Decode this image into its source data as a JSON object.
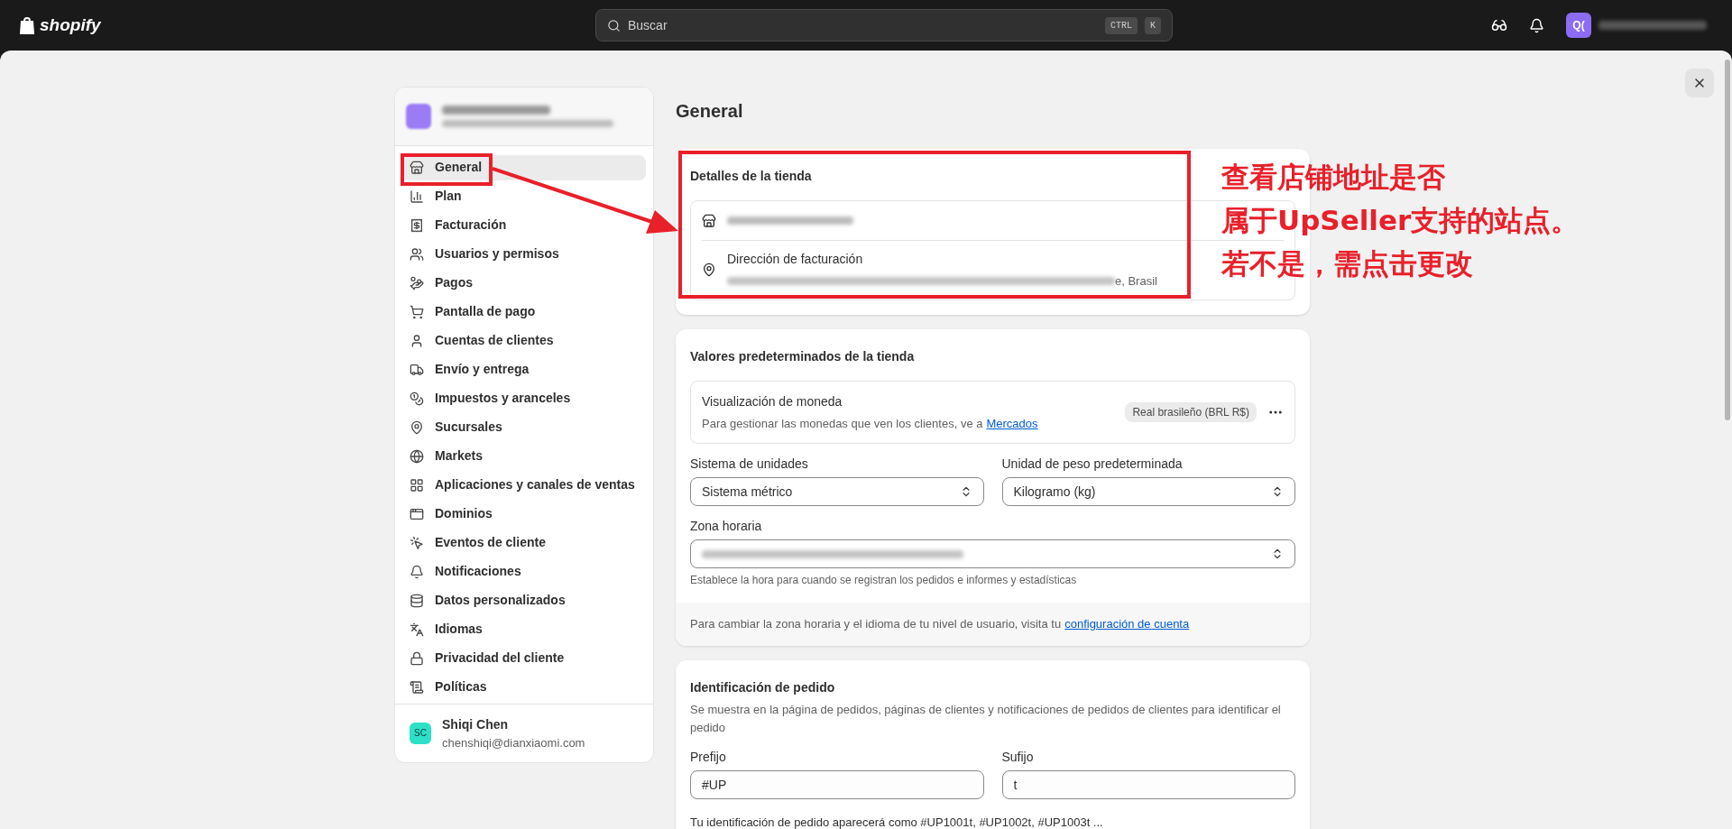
{
  "top_bar": {
    "logo": "shopify",
    "search": {
      "placeholder": "Buscar",
      "shortcut": [
        "CTRL",
        "K"
      ]
    },
    "avatar_initials": "Q("
  },
  "sidebar": {
    "items": [
      {
        "label": "General",
        "selected": true
      },
      {
        "label": "Plan",
        "selected": false
      },
      {
        "label": "Facturación",
        "selected": false
      },
      {
        "label": "Usuarios y permisos",
        "selected": false
      },
      {
        "label": "Pagos",
        "selected": false
      },
      {
        "label": "Pantalla de pago",
        "selected": false
      },
      {
        "label": "Cuentas de clientes",
        "selected": false
      },
      {
        "label": "Envío y entrega",
        "selected": false
      },
      {
        "label": "Impuestos y aranceles",
        "selected": false
      },
      {
        "label": "Sucursales",
        "selected": false
      },
      {
        "label": "Markets",
        "selected": false
      },
      {
        "label": "Aplicaciones y canales de ventas",
        "selected": false
      },
      {
        "label": "Dominios",
        "selected": false
      },
      {
        "label": "Eventos de cliente",
        "selected": false
      },
      {
        "label": "Notificaciones",
        "selected": false
      },
      {
        "label": "Datos personalizados",
        "selected": false
      },
      {
        "label": "Idiomas",
        "selected": false
      },
      {
        "label": "Privacidad del cliente",
        "selected": false
      },
      {
        "label": "Políticas",
        "selected": false
      }
    ],
    "user": {
      "initials": "SC",
      "name": "Shiqi Chen",
      "email": "chenshiqi@dianxiaomi.com"
    }
  },
  "page_title": "General",
  "store_details": {
    "title": "Detalles de la tienda",
    "billing_label": "Dirección de facturación",
    "billing_visible_tail": "e, Brasil"
  },
  "store_defaults": {
    "title": "Valores predeterminados de la tienda",
    "currency": {
      "label": "Visualización de moneda",
      "hint": "Para gestionar las monedas que ven los clientes, ve a",
      "link": "Mercados",
      "badge": "Real brasileño (BRL R$)"
    },
    "fields": [
      {
        "label": "Sistema de unidades",
        "value": "Sistema métrico"
      },
      {
        "label": "Unidad de peso predeterminada",
        "value": "Kilogramo (kg)"
      }
    ],
    "timezone": {
      "label": "Zona horaria",
      "help": "Establece la hora para cuando se registran los pedidos e informes y estadísticas"
    },
    "footer": {
      "text": "Para cambiar la zona horaria y el idioma de tu nivel de usuario, visita tu",
      "link": "configuración de cuenta"
    }
  },
  "order_id": {
    "title": "Identificación de pedido",
    "description": "Se muestra en la página de pedidos, páginas de clientes y notificaciones de pedidos de clientes para identificar el pedido",
    "fields": [
      {
        "label": "Prefijo",
        "value": "#UP"
      },
      {
        "label": "Sufijo",
        "value": "t"
      }
    ],
    "preview": "Tu identificación de pedido aparecerá como #UP1001t, #UP1002t, #UP1003t ..."
  },
  "annotation": {
    "lines": [
      "查看店铺地址是否",
      "属于UpSeller支持的站点。",
      "若不是，需点击更改"
    ]
  }
}
